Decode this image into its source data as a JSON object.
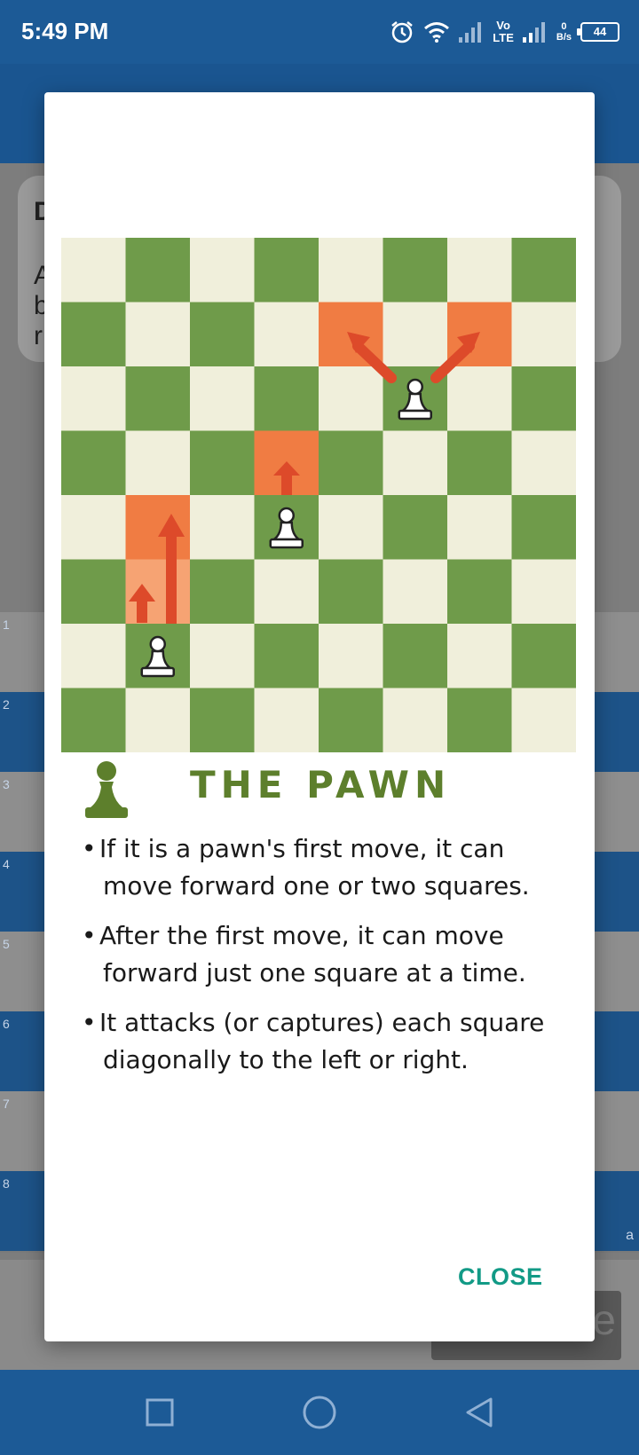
{
  "status_bar": {
    "time": "5:49 PM",
    "volte_top": "Vo",
    "volte_bottom": "LTE",
    "net_speed_value": "0",
    "net_speed_unit": "B/s",
    "battery": "44",
    "icons": [
      "alarm-icon",
      "wifi-icon",
      "signal-icon",
      "signal-icon",
      "battery-icon"
    ]
  },
  "background": {
    "card_letters": [
      "D",
      "A",
      "b",
      "r"
    ],
    "rank_numbers": [
      "1",
      "2",
      "3",
      "4",
      "5",
      "6",
      "7",
      "8"
    ],
    "file_letter": "a",
    "button_letter": "e"
  },
  "dialog": {
    "board": {
      "light_color": "#f0efdb",
      "dark_color": "#6f9b4a",
      "highlight_color": "#f07c43",
      "highlight_light_color": "#f6a373",
      "arrow_color": "#dd4a2a",
      "pawns": [
        "white-pawn",
        "white-pawn",
        "white-pawn"
      ],
      "moves": [
        "one-square-forward",
        "two-squares-forward",
        "one-square-forward",
        "capture-diagonal-left",
        "capture-diagonal-right"
      ]
    },
    "title_icon": "pawn-icon",
    "title": "THE PAWN",
    "rules": [
      {
        "line1": "If it is a pawn's first move, it can",
        "line2": "move forward one or two squares."
      },
      {
        "line1": "After the first move, it can move",
        "line2": "forward just one square at a time."
      },
      {
        "line1": "It attacks (or captures) each square",
        "line2": "diagonally to the left or right."
      }
    ],
    "bullet": "•",
    "close_label": "CLOSE",
    "accent_color": "#129a86",
    "title_color": "#5d7f2c"
  },
  "nav_bar": {
    "buttons": [
      "recents-square-icon",
      "home-circle-icon",
      "back-triangle-icon"
    ]
  }
}
